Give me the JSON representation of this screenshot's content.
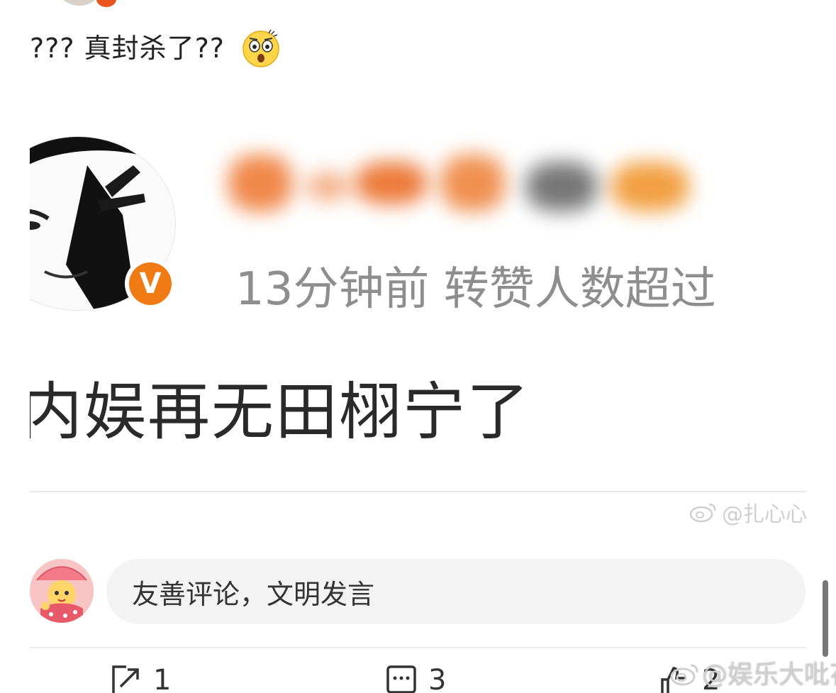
{
  "post": {
    "text": "??? 真封杀了??",
    "emoji": "shocked-face-emoji"
  },
  "embedded_screenshot": {
    "meta_text": "13分钟前 转赞人数超过",
    "headline": "内娱再无田栩宁了",
    "verified_badge": "V",
    "watermark": "@扎心心"
  },
  "comment_box": {
    "placeholder": "友善评论，文明发言"
  },
  "actions": {
    "repost_count": "1",
    "comment_count": "3",
    "like_count": "2"
  },
  "watermark": {
    "text": "@娱乐大吡花"
  },
  "colors": {
    "verified_orange": "#f07a13",
    "muted_text": "#8e8e8e",
    "input_bg": "#f3f3f3"
  }
}
